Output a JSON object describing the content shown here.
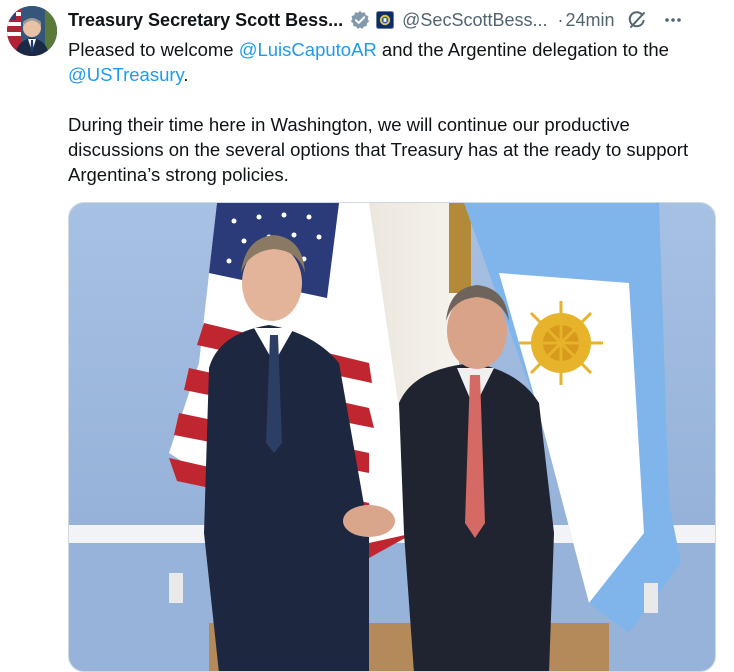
{
  "tweet": {
    "author_name": "Treasury Secretary Scott Bess...",
    "handle": "@SecScottBess...",
    "separator": "·",
    "time": "24min",
    "verified_icon": "verified-badge-icon",
    "org_icon": "us-treasury-seal-icon",
    "text_p1_before": "Pleased to welcome ",
    "mention_1": "@LuisCaputoAR",
    "text_p1_middle": " and the Argentine delegation to the ",
    "mention_2": "@USTreasury",
    "text_p1_after": ".",
    "text_p2": "During their time here in Washington, we will continue our productive discussions on the several options that Treasury has at the ready to support Argentina’s strong policies."
  },
  "colors": {
    "link": "#1d9bf0",
    "text": "#0f1419",
    "secondary": "#536471",
    "verified_badge": "#829aab"
  }
}
